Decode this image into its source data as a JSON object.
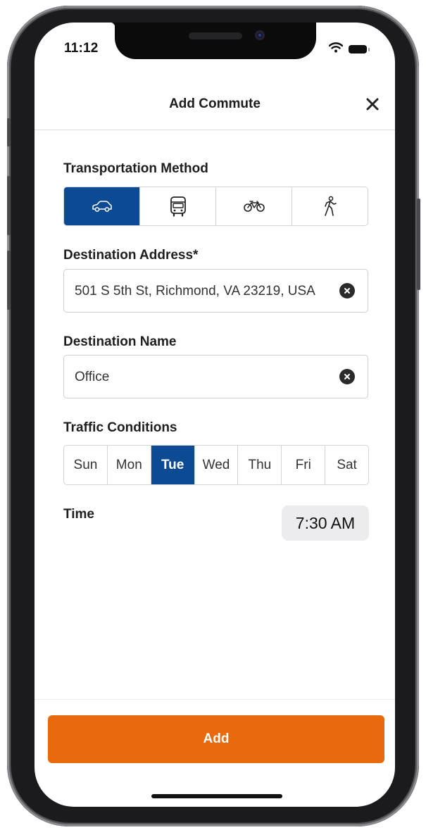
{
  "status_bar": {
    "time": "11:12"
  },
  "header": {
    "title": "Add Commute"
  },
  "transportation": {
    "label": "Transportation Method",
    "options": [
      {
        "icon": "car-icon",
        "selected": true
      },
      {
        "icon": "bus-icon",
        "selected": false
      },
      {
        "icon": "bicycle-icon",
        "selected": false
      },
      {
        "icon": "walking-icon",
        "selected": false
      }
    ]
  },
  "destination_address": {
    "label": "Destination Address*",
    "value": "501 S 5th St, Richmond, VA 23219, USA"
  },
  "destination_name": {
    "label": "Destination Name",
    "value": "Office"
  },
  "traffic": {
    "label": "Traffic Conditions",
    "days": [
      "Sun",
      "Mon",
      "Tue",
      "Wed",
      "Thu",
      "Fri",
      "Sat"
    ],
    "selected_day": "Tue"
  },
  "time": {
    "label": "Time",
    "value": "7:30 AM"
  },
  "actions": {
    "add_label": "Add"
  },
  "colors": {
    "primary_blue": "#0c4a94",
    "accent_orange": "#e86a0d"
  }
}
